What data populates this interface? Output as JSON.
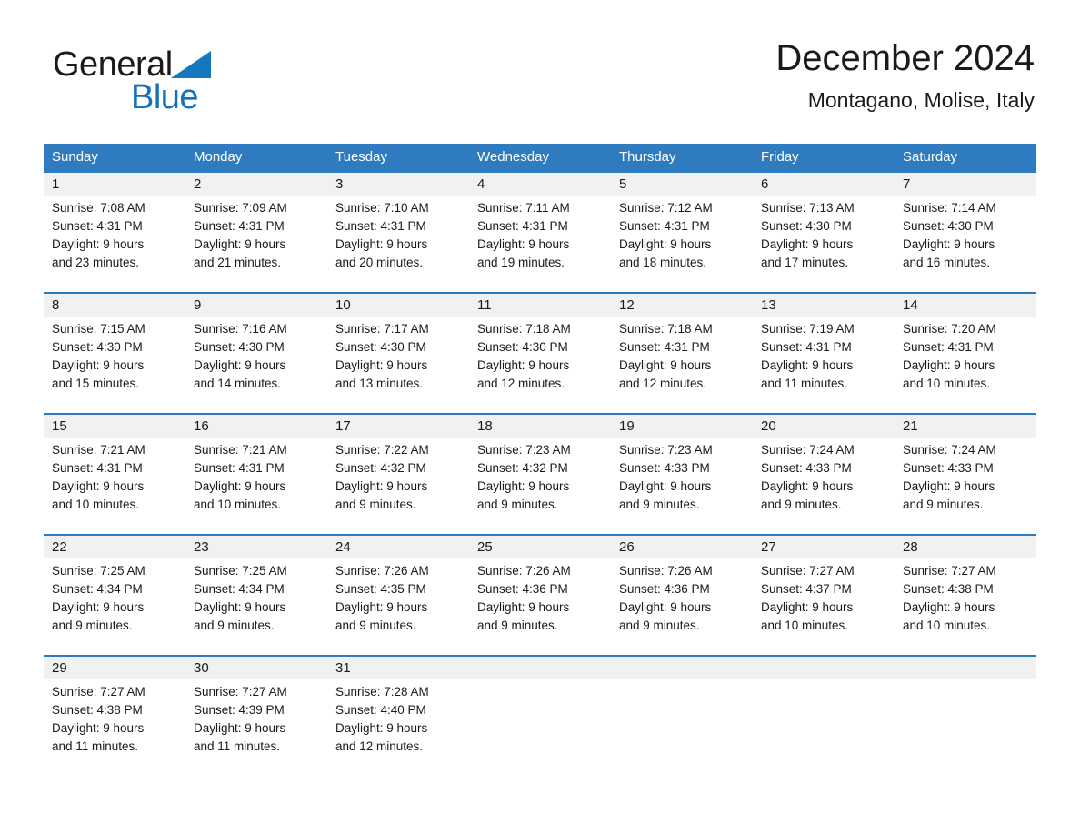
{
  "brand": {
    "name_part1": "General",
    "name_part2": "Blue",
    "triangle_color": "#1577bd",
    "blue_color": "#1570b8"
  },
  "header": {
    "title": "December 2024",
    "subtitle": "Montagano, Molise, Italy"
  },
  "colors": {
    "header_bar": "#2e7cbf",
    "daynum_band": "#f1f1f1",
    "text": "#1a1a1a",
    "header_text": "#ffffff",
    "week_divider": "#2e7cbf"
  },
  "weekdays": [
    "Sunday",
    "Monday",
    "Tuesday",
    "Wednesday",
    "Thursday",
    "Friday",
    "Saturday"
  ],
  "weeks": [
    {
      "days": [
        {
          "date": "1",
          "info": "Sunrise: 7:08 AM\nSunset: 4:31 PM\nDaylight: 9 hours\nand 23 minutes."
        },
        {
          "date": "2",
          "info": "Sunrise: 7:09 AM\nSunset: 4:31 PM\nDaylight: 9 hours\nand 21 minutes."
        },
        {
          "date": "3",
          "info": "Sunrise: 7:10 AM\nSunset: 4:31 PM\nDaylight: 9 hours\nand 20 minutes."
        },
        {
          "date": "4",
          "info": "Sunrise: 7:11 AM\nSunset: 4:31 PM\nDaylight: 9 hours\nand 19 minutes."
        },
        {
          "date": "5",
          "info": "Sunrise: 7:12 AM\nSunset: 4:31 PM\nDaylight: 9 hours\nand 18 minutes."
        },
        {
          "date": "6",
          "info": "Sunrise: 7:13 AM\nSunset: 4:30 PM\nDaylight: 9 hours\nand 17 minutes."
        },
        {
          "date": "7",
          "info": "Sunrise: 7:14 AM\nSunset: 4:30 PM\nDaylight: 9 hours\nand 16 minutes."
        }
      ]
    },
    {
      "days": [
        {
          "date": "8",
          "info": "Sunrise: 7:15 AM\nSunset: 4:30 PM\nDaylight: 9 hours\nand 15 minutes."
        },
        {
          "date": "9",
          "info": "Sunrise: 7:16 AM\nSunset: 4:30 PM\nDaylight: 9 hours\nand 14 minutes."
        },
        {
          "date": "10",
          "info": "Sunrise: 7:17 AM\nSunset: 4:30 PM\nDaylight: 9 hours\nand 13 minutes."
        },
        {
          "date": "11",
          "info": "Sunrise: 7:18 AM\nSunset: 4:30 PM\nDaylight: 9 hours\nand 12 minutes."
        },
        {
          "date": "12",
          "info": "Sunrise: 7:18 AM\nSunset: 4:31 PM\nDaylight: 9 hours\nand 12 minutes."
        },
        {
          "date": "13",
          "info": "Sunrise: 7:19 AM\nSunset: 4:31 PM\nDaylight: 9 hours\nand 11 minutes."
        },
        {
          "date": "14",
          "info": "Sunrise: 7:20 AM\nSunset: 4:31 PM\nDaylight: 9 hours\nand 10 minutes."
        }
      ]
    },
    {
      "days": [
        {
          "date": "15",
          "info": "Sunrise: 7:21 AM\nSunset: 4:31 PM\nDaylight: 9 hours\nand 10 minutes."
        },
        {
          "date": "16",
          "info": "Sunrise: 7:21 AM\nSunset: 4:31 PM\nDaylight: 9 hours\nand 10 minutes."
        },
        {
          "date": "17",
          "info": "Sunrise: 7:22 AM\nSunset: 4:32 PM\nDaylight: 9 hours\nand 9 minutes."
        },
        {
          "date": "18",
          "info": "Sunrise: 7:23 AM\nSunset: 4:32 PM\nDaylight: 9 hours\nand 9 minutes."
        },
        {
          "date": "19",
          "info": "Sunrise: 7:23 AM\nSunset: 4:33 PM\nDaylight: 9 hours\nand 9 minutes."
        },
        {
          "date": "20",
          "info": "Sunrise: 7:24 AM\nSunset: 4:33 PM\nDaylight: 9 hours\nand 9 minutes."
        },
        {
          "date": "21",
          "info": "Sunrise: 7:24 AM\nSunset: 4:33 PM\nDaylight: 9 hours\nand 9 minutes."
        }
      ]
    },
    {
      "days": [
        {
          "date": "22",
          "info": "Sunrise: 7:25 AM\nSunset: 4:34 PM\nDaylight: 9 hours\nand 9 minutes."
        },
        {
          "date": "23",
          "info": "Sunrise: 7:25 AM\nSunset: 4:34 PM\nDaylight: 9 hours\nand 9 minutes."
        },
        {
          "date": "24",
          "info": "Sunrise: 7:26 AM\nSunset: 4:35 PM\nDaylight: 9 hours\nand 9 minutes."
        },
        {
          "date": "25",
          "info": "Sunrise: 7:26 AM\nSunset: 4:36 PM\nDaylight: 9 hours\nand 9 minutes."
        },
        {
          "date": "26",
          "info": "Sunrise: 7:26 AM\nSunset: 4:36 PM\nDaylight: 9 hours\nand 9 minutes."
        },
        {
          "date": "27",
          "info": "Sunrise: 7:27 AM\nSunset: 4:37 PM\nDaylight: 9 hours\nand 10 minutes."
        },
        {
          "date": "28",
          "info": "Sunrise: 7:27 AM\nSunset: 4:38 PM\nDaylight: 9 hours\nand 10 minutes."
        }
      ]
    },
    {
      "days": [
        {
          "date": "29",
          "info": "Sunrise: 7:27 AM\nSunset: 4:38 PM\nDaylight: 9 hours\nand 11 minutes."
        },
        {
          "date": "30",
          "info": "Sunrise: 7:27 AM\nSunset: 4:39 PM\nDaylight: 9 hours\nand 11 minutes."
        },
        {
          "date": "31",
          "info": "Sunrise: 7:28 AM\nSunset: 4:40 PM\nDaylight: 9 hours\nand 12 minutes."
        },
        {
          "date": "",
          "info": ""
        },
        {
          "date": "",
          "info": ""
        },
        {
          "date": "",
          "info": ""
        },
        {
          "date": "",
          "info": ""
        }
      ]
    }
  ]
}
